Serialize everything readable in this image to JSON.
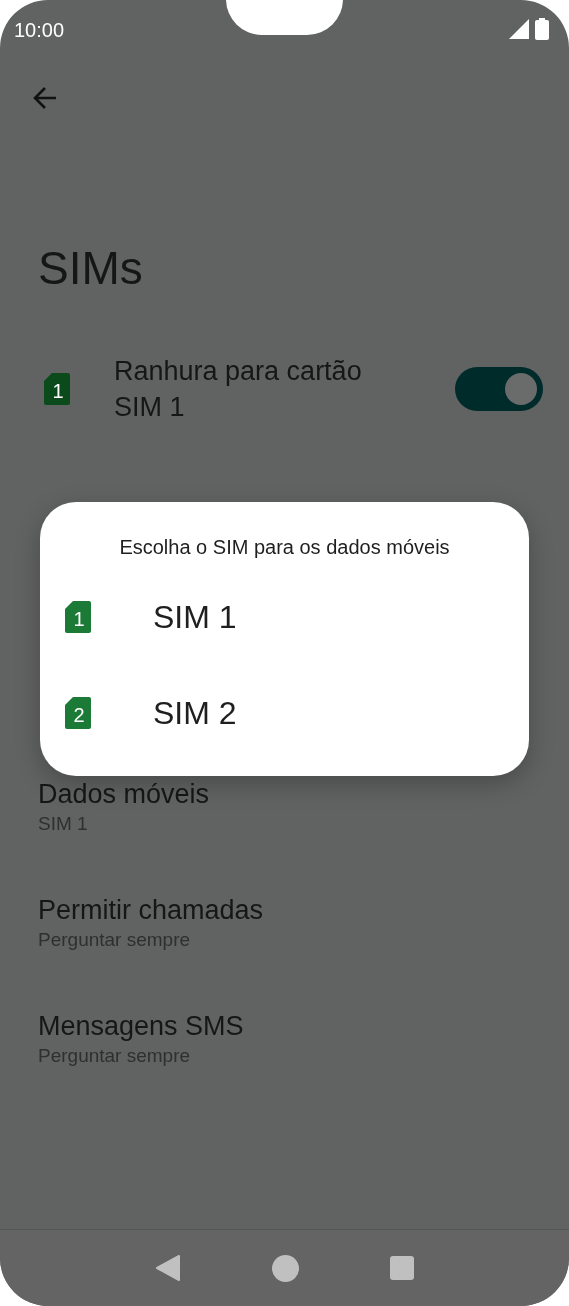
{
  "status_bar": {
    "time": "10:00"
  },
  "page": {
    "title": "SIMs"
  },
  "sim_slots": [
    {
      "title": "Ranhura para cartão SIM 1",
      "slot": "1",
      "on": true
    }
  ],
  "settings": [
    {
      "title": "Dados móveis",
      "value": "SIM 1"
    },
    {
      "title": "Permitir chamadas",
      "value": "Perguntar sempre"
    },
    {
      "title": "Mensagens SMS",
      "value": "Perguntar sempre"
    }
  ],
  "dialog": {
    "title": "Escolha o SIM para os dados móveis",
    "options": [
      {
        "label": "SIM 1",
        "slot": "1"
      },
      {
        "label": "SIM 2",
        "slot": "2"
      }
    ]
  }
}
